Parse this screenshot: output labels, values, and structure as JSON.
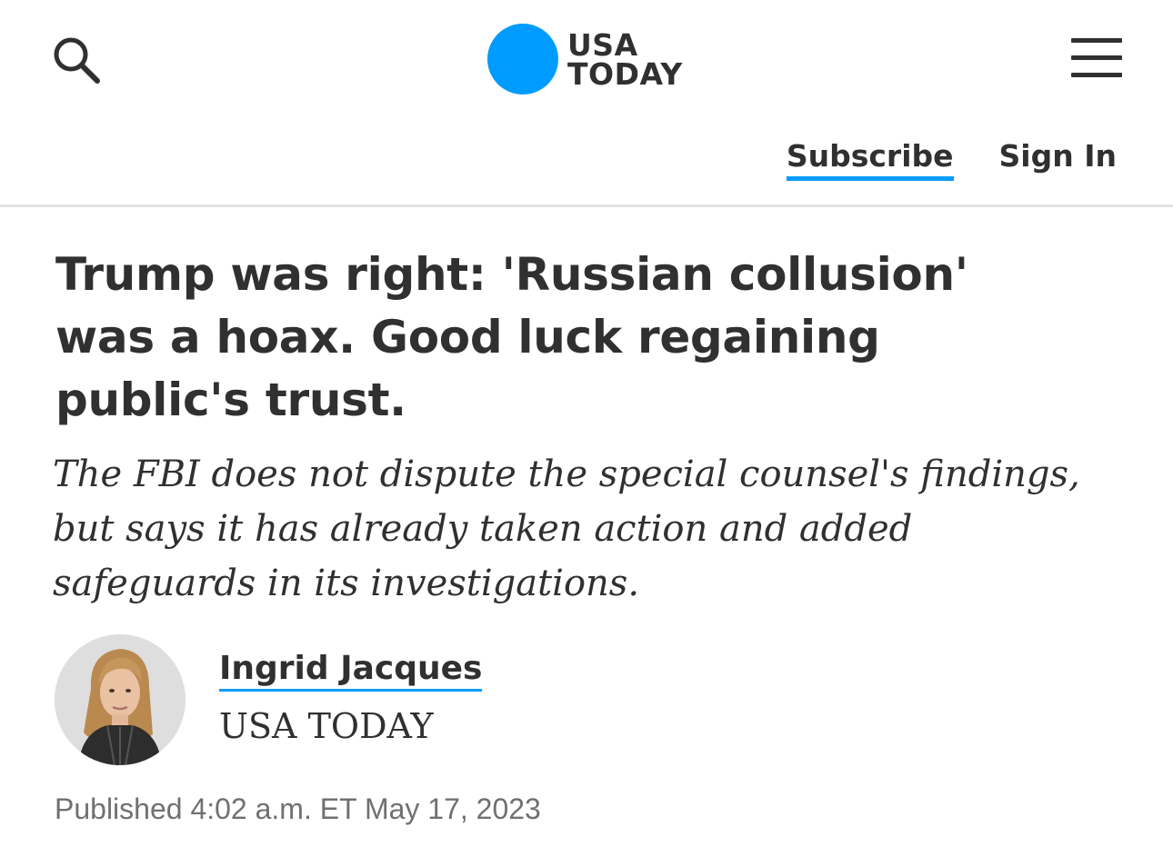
{
  "colors": {
    "brand_blue": "#009bff",
    "text": "#303030",
    "meta": "#707070",
    "divider": "#e3e3e3"
  },
  "header": {
    "search_icon": "search-icon",
    "logo": {
      "line1": "USA",
      "line2": "TODAY"
    },
    "menu_icon": "hamburger-menu-icon",
    "subscribe_label": "Subscribe",
    "signin_label": "Sign In"
  },
  "article": {
    "headline": "Trump was right: 'Russian collusion' was a hoax. Good luck regaining public's trust.",
    "subheadline": "The FBI does not dispute the special counsel's findings, but says it has already taken action and added safeguards in its investigations.",
    "author": {
      "name": "Ingrid Jacques",
      "organization": "USA TODAY",
      "avatar_icon": "author-photo"
    },
    "published": "Published 4:02 a.m. ET May 17, 2023"
  }
}
